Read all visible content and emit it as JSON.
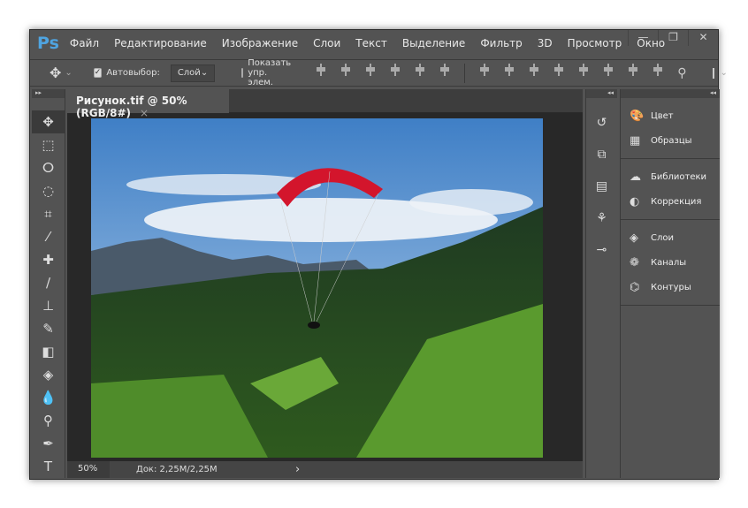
{
  "app": {
    "logo": "Ps"
  },
  "menu": [
    "Файл",
    "Редактирование",
    "Изображение",
    "Слои",
    "Текст",
    "Выделение",
    "Фильтр",
    "3D",
    "Просмотр",
    "Окно"
  ],
  "window_controls": {
    "minimize": "—",
    "restore": "❐",
    "close": "✕"
  },
  "options": {
    "autoselect_label": "Автовыбор:",
    "autoselect_checked": true,
    "autoselect_value": "Слой",
    "show_controls_label": "Показать упр. элем.",
    "show_controls_checked": false
  },
  "document": {
    "tab_title": "Рисунок.tif @ 50% (RGB/8#)",
    "close": "×",
    "zoom": "50%",
    "doc_info": "Док: 2,25M/2,25M",
    "arrow": "›"
  },
  "tools": [
    "move",
    "marquee",
    "lasso",
    "quick-select",
    "crop",
    "eyedropper",
    "healing",
    "brush",
    "stamp",
    "history-brush",
    "eraser",
    "paint-bucket",
    "blur",
    "dodge",
    "pen",
    "type"
  ],
  "tool_glyphs": [
    "✥",
    "⬚",
    "ⵔ",
    "◌",
    "⌗",
    "⁄",
    "✚",
    "∕",
    "⊥",
    "✎",
    "◧",
    "◈",
    "💧",
    "⚲",
    "✒",
    "T"
  ],
  "panel_icons": [
    "history",
    "3d",
    "properties",
    "brushes",
    "adjust"
  ],
  "panels": [
    [
      {
        "label": "Цвет",
        "icon": "palette"
      },
      {
        "label": "Образцы",
        "icon": "swatches"
      }
    ],
    [
      {
        "label": "Библиотеки",
        "icon": "libraries"
      },
      {
        "label": "Коррекция",
        "icon": "adjustments"
      }
    ],
    [
      {
        "label": "Слои",
        "icon": "layers"
      },
      {
        "label": "Каналы",
        "icon": "channels"
      },
      {
        "label": "Контуры",
        "icon": "paths"
      }
    ]
  ]
}
